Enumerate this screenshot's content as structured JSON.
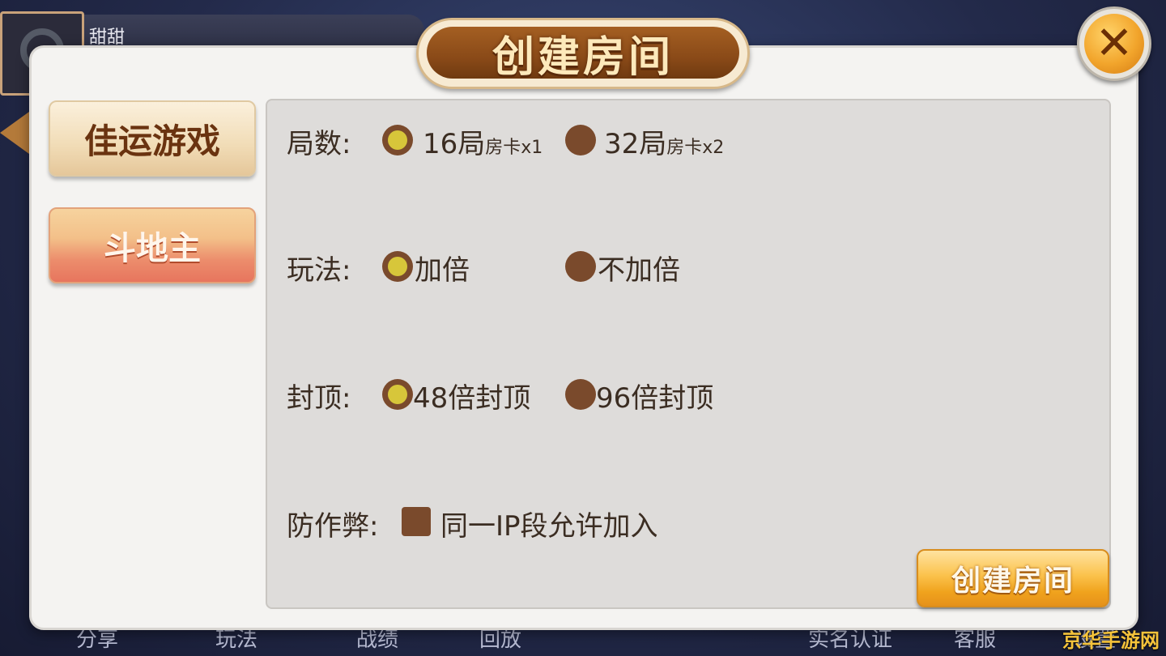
{
  "background": {
    "username": "甜甜",
    "bottom_nav": [
      "分享",
      "玩法",
      "战绩",
      "回放",
      "实名认证",
      "客服",
      "设置"
    ]
  },
  "modal": {
    "title": "创建房间",
    "close_icon": "close-x-icon"
  },
  "tabs": [
    {
      "label": "佳运游戏",
      "active": true
    },
    {
      "label": "斗地主",
      "active": false
    }
  ],
  "settings": {
    "rounds": {
      "label": "局数:",
      "options": [
        {
          "main": "16局",
          "sub": "房卡x1",
          "selected": true
        },
        {
          "main": "32局",
          "sub": "房卡x2",
          "selected": false
        }
      ]
    },
    "mode": {
      "label": "玩法:",
      "options": [
        {
          "text": "加倍",
          "selected": true
        },
        {
          "text": "不加倍",
          "selected": false
        }
      ]
    },
    "cap": {
      "label": "封顶:",
      "options": [
        {
          "text": "48倍封顶",
          "selected": true
        },
        {
          "text": "96倍封顶",
          "selected": false
        }
      ]
    },
    "anti_cheat": {
      "label": "防作弊:",
      "checkbox_text": "同一IP段允许加入",
      "checked": false
    }
  },
  "create_button": "创建房间",
  "watermark": "京华手游网",
  "colors": {
    "accent_brown": "#7a4a2c",
    "selected_dot": "#d7c63a",
    "button_orange": "#f0a31d"
  }
}
